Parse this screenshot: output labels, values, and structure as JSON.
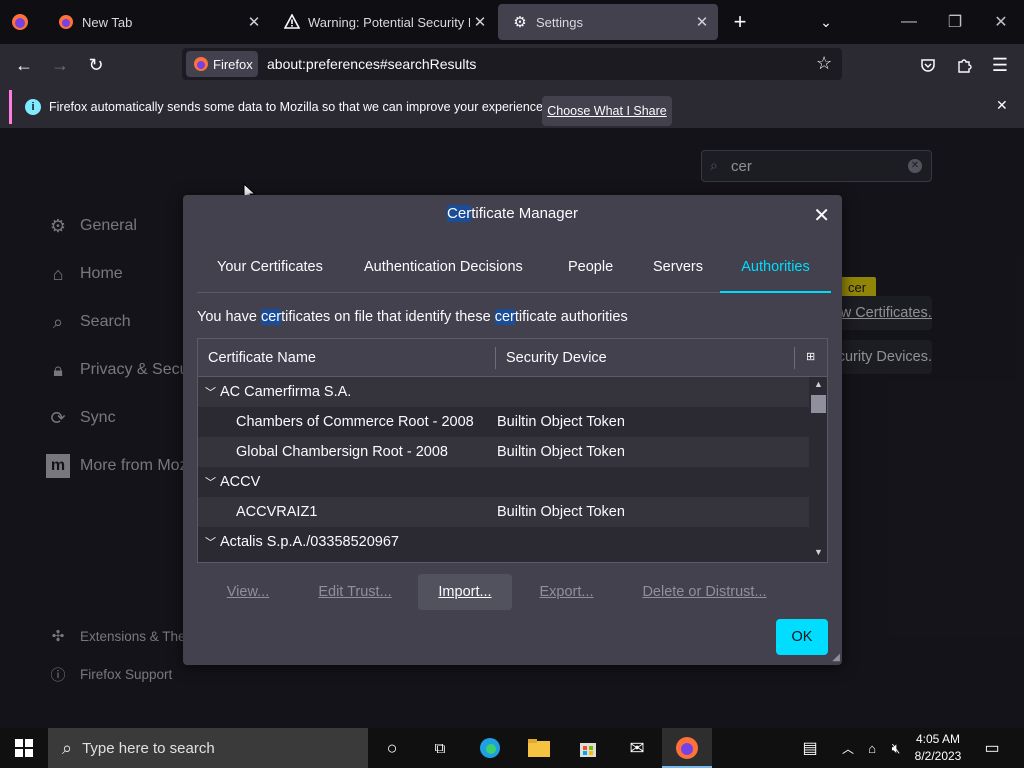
{
  "tabs": [
    {
      "label": "New Tab",
      "icon": "firefox-icon"
    },
    {
      "label": "Warning: Potential Security Risk",
      "icon": "warning-icon"
    },
    {
      "label": "Settings",
      "icon": "gear-icon",
      "selected": true
    }
  ],
  "navbar": {
    "identity_label": "Firefox",
    "url": "about:preferences#searchResults"
  },
  "notification": {
    "text": "Firefox automatically sends some data to Mozilla so that we can improve your experience.",
    "button": "Choose What I Share"
  },
  "settings": {
    "search_value": "cer",
    "nav": [
      "General",
      "Home",
      "Search",
      "Privacy & Security",
      "Sync",
      "More from Mozilla"
    ],
    "footer": [
      "Extensions & Themes",
      "Firefox Support"
    ],
    "bg_buttons": [
      "View Certificates...",
      "Security Devices..."
    ],
    "badge": "cer"
  },
  "dialog": {
    "title_hl": "Cer",
    "title_rest": "tificate Manager",
    "tabs": [
      "Your Certificates",
      "Authentication Decisions",
      "People",
      "Servers",
      "Authorities"
    ],
    "active_tab": "Authorities",
    "desc_1": "You have ",
    "desc_hl1": "cer",
    "desc_2": "tificates on file that identify these ",
    "desc_hl2": "cer",
    "desc_3": "tificate authorities",
    "columns": [
      "Certificate Name",
      "Security Device"
    ],
    "rows": [
      {
        "name": "AC Camerfirma S.A.",
        "device": "",
        "group": true
      },
      {
        "name": "Chambers of Commerce Root - 2008",
        "device": "Builtin Object Token",
        "group": false
      },
      {
        "name": "Global Chambersign Root - 2008",
        "device": "Builtin Object Token",
        "group": false
      },
      {
        "name": "ACCV",
        "device": "",
        "group": true
      },
      {
        "name": "ACCVRAIZ1",
        "device": "Builtin Object Token",
        "group": false
      },
      {
        "name": "Actalis S.p.A./03358520967",
        "device": "",
        "group": true
      }
    ],
    "buttons": [
      "View...",
      "Edit Trust...",
      "Import...",
      "Export...",
      "Delete or Distrust..."
    ],
    "ok": "OK"
  },
  "taskbar": {
    "search_placeholder": "Type here to search",
    "time": "4:05 AM",
    "date": "8/2/2023"
  },
  "colors": {
    "accent": "#00ddff",
    "highlight": "#1a4d99",
    "notif_bar": "#ff7ce1"
  }
}
